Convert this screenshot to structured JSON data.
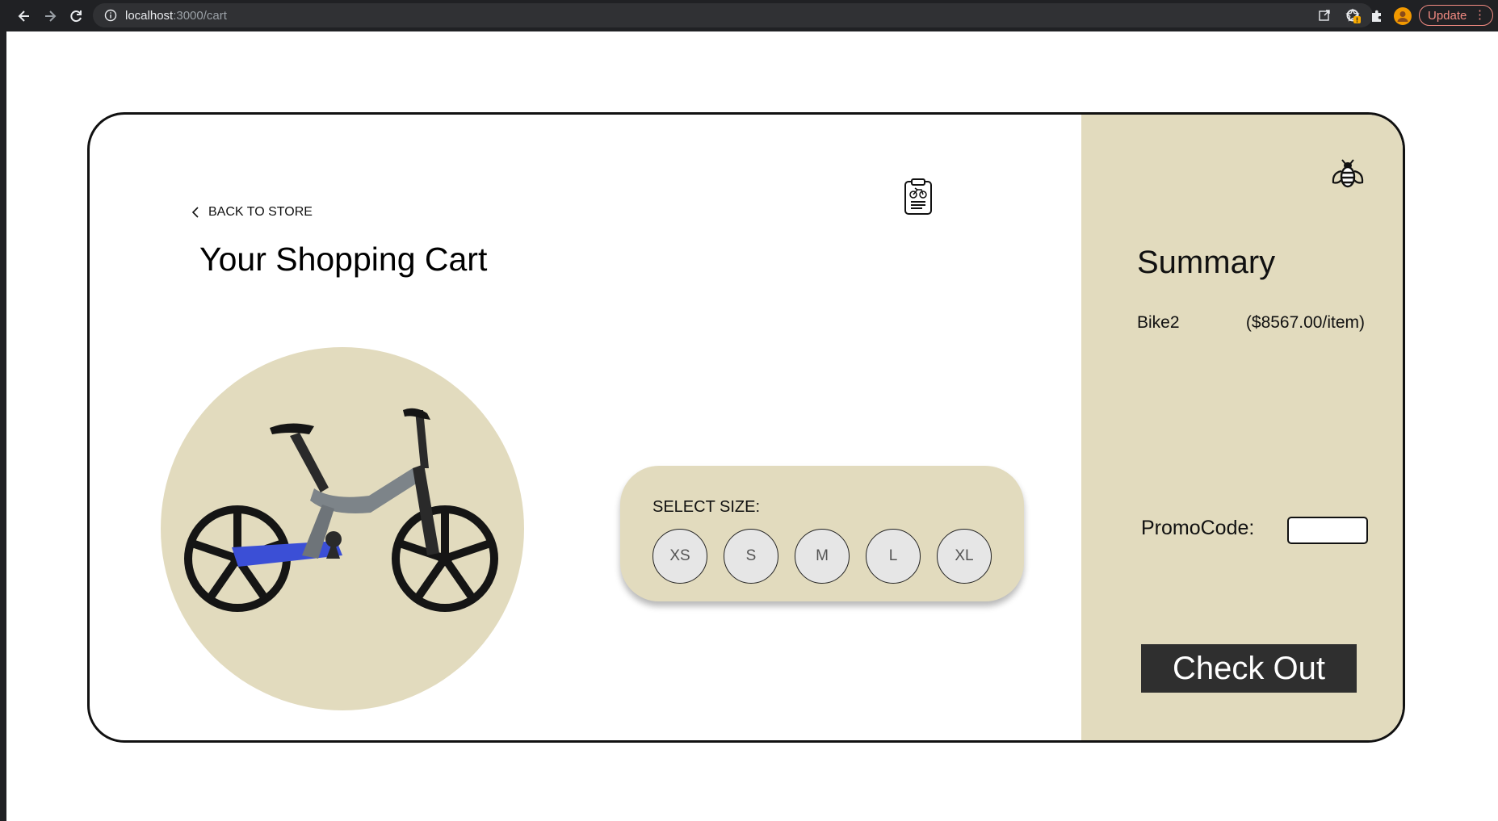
{
  "browser": {
    "url_host": "localhost",
    "url_path": ":3000/cart",
    "update_label": "Update",
    "menu_glyph": "⋮"
  },
  "page": {
    "back_label": "BACK TO STORE",
    "title": "Your Shopping Cart",
    "product_image": "bike-image",
    "size_label": "SELECT SIZE:",
    "sizes": [
      "XS",
      "S",
      "M",
      "L",
      "XL"
    ]
  },
  "summary": {
    "title": "Summary",
    "item_name": "Bike2",
    "item_price": "($8567.00/item)",
    "promo_label": "PromoCode:",
    "promo_value": "",
    "checkout_label": "Check Out"
  },
  "colors": {
    "accent_beige": "#e2dbbe",
    "checkout_bg": "#2f2f2f",
    "bike_blue": "#3b4fd6",
    "bike_grey": "#7d8489",
    "update_red": "#f28b82"
  }
}
